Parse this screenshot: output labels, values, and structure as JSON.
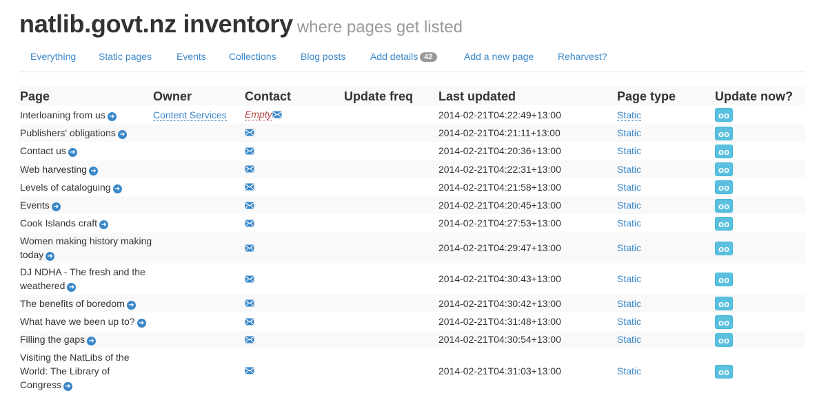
{
  "header": {
    "title": "natlib.govt.nz inventory",
    "subtitle": "where pages get listed"
  },
  "nav": {
    "everything": "Everything",
    "static_pages": "Static pages",
    "events": "Events",
    "collections": "Collections",
    "blog_posts": "Blog posts",
    "add_details": "Add details",
    "add_details_count": "42",
    "add_new_page": "Add a new page",
    "reharvest": "Reharvest?"
  },
  "table": {
    "headers": {
      "page": "Page",
      "owner": "Owner",
      "contact": "Contact",
      "update_freq": "Update freq",
      "last_updated": "Last updated",
      "page_type": "Page type",
      "update_now": "Update now?"
    },
    "button_label": "oo",
    "rows": [
      {
        "page": "Interloaning from us",
        "owner": "Content Services",
        "contact": "Empty",
        "last_updated": "2014-02-21T04:22:49+13:00",
        "type": "Static"
      },
      {
        "page": "Publishers' obligations",
        "owner": "",
        "contact": "",
        "last_updated": "2014-02-21T04:21:11+13:00",
        "type": "Static"
      },
      {
        "page": "Contact us",
        "owner": "",
        "contact": "",
        "last_updated": "2014-02-21T04:20:36+13:00",
        "type": "Static"
      },
      {
        "page": "Web harvesting",
        "owner": "",
        "contact": "",
        "last_updated": "2014-02-21T04:22:31+13:00",
        "type": "Static"
      },
      {
        "page": "Levels of cataloguing",
        "owner": "",
        "contact": "",
        "last_updated": "2014-02-21T04:21:58+13:00",
        "type": "Static"
      },
      {
        "page": "Events",
        "owner": "",
        "contact": "",
        "last_updated": "2014-02-21T04:20:45+13:00",
        "type": "Static"
      },
      {
        "page": "Cook Islands craft",
        "owner": "",
        "contact": "",
        "last_updated": "2014-02-21T04:27:53+13:00",
        "type": "Static"
      },
      {
        "page": "Women making history making today",
        "owner": "",
        "contact": "",
        "last_updated": "2014-02-21T04:29:47+13:00",
        "type": "Static"
      },
      {
        "page": "DJ NDHA - The fresh and the weathered",
        "owner": "",
        "contact": "",
        "last_updated": "2014-02-21T04:30:43+13:00",
        "type": "Static"
      },
      {
        "page": "The benefits of boredom",
        "owner": "",
        "contact": "",
        "last_updated": "2014-02-21T04:30:42+13:00",
        "type": "Static"
      },
      {
        "page": "What have we been up to?",
        "owner": "",
        "contact": "",
        "last_updated": "2014-02-21T04:31:48+13:00",
        "type": "Static"
      },
      {
        "page": "Filling the gaps",
        "owner": "",
        "contact": "",
        "last_updated": "2014-02-21T04:30:54+13:00",
        "type": "Static"
      },
      {
        "page": "Visiting the NatLibs of the World: The Library of Congress",
        "owner": "",
        "contact": "",
        "last_updated": "2014-02-21T04:31:03+13:00",
        "type": "Static"
      }
    ]
  },
  "icons": {
    "go": "arrow-circle-right-icon",
    "mail": "envelope-icon"
  },
  "colors": {
    "link": "#3a87c8",
    "button": "#5bc0de",
    "empty": "#b94a48",
    "badge": "#999999"
  }
}
